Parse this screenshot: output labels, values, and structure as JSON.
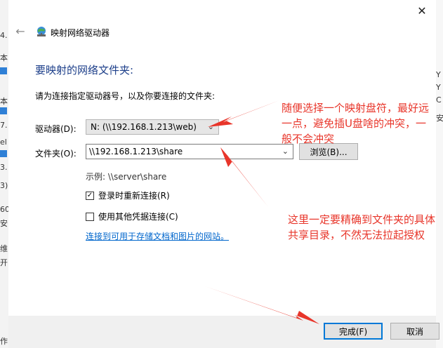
{
  "background_window": {
    "left_fragments": [
      "4.",
      "本",
      "本",
      "7.",
      "el",
      "3.",
      "3)",
      "60",
      "安",
      "维",
      "开",
      "作"
    ],
    "right_fragments": [
      "Y",
      "Y",
      "C",
      "安"
    ]
  },
  "dialog": {
    "title": "映射网络驱动器",
    "heading": "要映射的网络文件夹:",
    "instruction": "请为连接指定驱动器号，以及你要连接的文件夹:",
    "drive_label": "驱动器(D):",
    "drive_value": "N: (\\\\192.168.1.213\\web)",
    "folder_label": "文件夹(O):",
    "folder_value": "\\\\192.168.1.213\\share",
    "browse_label": "浏览(B)...",
    "example": "示例: \\\\server\\share",
    "reconnect_label": "登录时重新连接(R)",
    "reconnect_checked": true,
    "other_credentials_label": "使用其他凭据连接(C)",
    "other_credentials_checked": false,
    "link_text": "连接到可用于存储文档和图片的网站。",
    "finish_label": "完成(F)",
    "cancel_label": "取消"
  },
  "annotations": {
    "note1": "随便选择一个映射盘符，最好远一点，避免插U盘啥的冲突，一般不会冲突",
    "note2": "这里一定要精确到文件夹的具体共享目录，不然无法拉起授权"
  },
  "colors": {
    "accent": "#0078d7",
    "heading": "#1d3f8a",
    "annotation": "#e8352a",
    "link": "#0066cc"
  }
}
